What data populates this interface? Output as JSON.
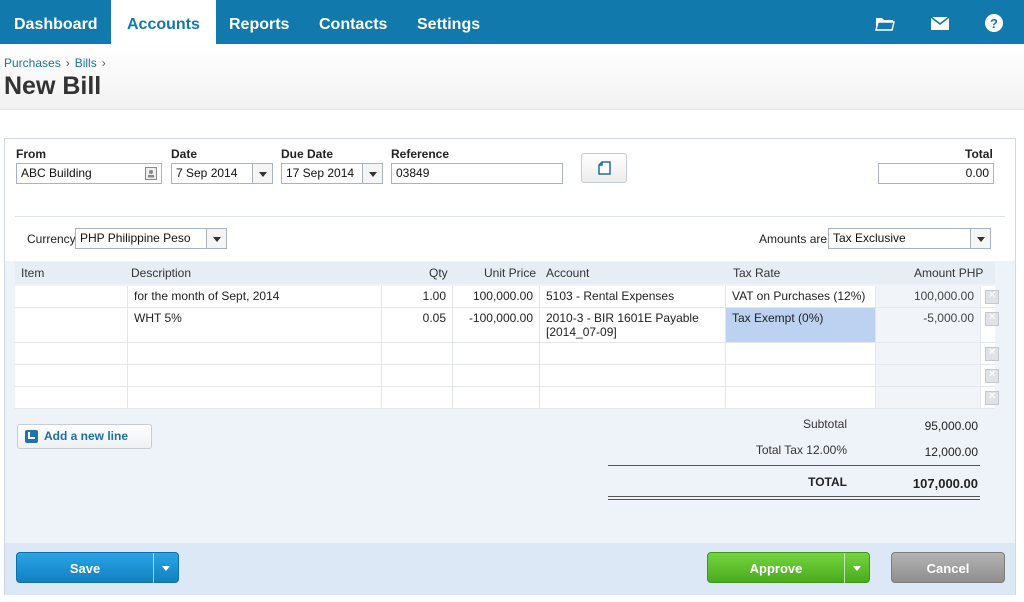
{
  "nav": {
    "tabs": [
      "Dashboard",
      "Accounts",
      "Reports",
      "Contacts",
      "Settings"
    ],
    "active": "Accounts"
  },
  "breadcrumb": {
    "items": [
      "Purchases",
      "Bills"
    ],
    "sep": "›"
  },
  "page_title": "New Bill",
  "form": {
    "from_label": "From",
    "from_value": "ABC Building",
    "date_label": "Date",
    "date_value": "7 Sep 2014",
    "due_label": "Due Date",
    "due_value": "17 Sep 2014",
    "ref_label": "Reference",
    "ref_value": "03849",
    "total_label": "Total",
    "total_value": "0.00",
    "currency_label": "Currency",
    "currency_value": "PHP Philippine Peso",
    "amounts_label": "Amounts are",
    "amounts_value": "Tax Exclusive"
  },
  "table": {
    "headers": {
      "item": "Item",
      "description": "Description",
      "qty": "Qty",
      "unit_price": "Unit Price",
      "account": "Account",
      "tax_rate": "Tax Rate",
      "amount": "Amount PHP"
    },
    "rows": [
      {
        "item": "",
        "description": "for the month of Sept, 2014",
        "qty": "1.00",
        "unit_price": "100,000.00",
        "account": "5103 - Rental Expenses",
        "tax_rate": "VAT on Purchases (12%)",
        "amount": "100,000.00"
      },
      {
        "item": "",
        "description": "WHT 5%",
        "qty": "0.05",
        "unit_price": "-100,000.00",
        "account": "2010-3 - BIR 1601E Payable [2014_07-09]",
        "tax_rate": "Tax Exempt (0%)",
        "amount": "-5,000.00"
      }
    ]
  },
  "add_line_label": "Add a new line",
  "totals": {
    "subtotal_label": "Subtotal",
    "subtotal_value": "95,000.00",
    "tax_label": "Total Tax 12.00%",
    "tax_value": "12,000.00",
    "total_label": "TOTAL",
    "total_value": "107,000.00"
  },
  "buttons": {
    "save": "Save",
    "approve": "Approve",
    "cancel": "Cancel"
  },
  "colors": {
    "nav": "#1279ad",
    "save": "#1b8fd0",
    "approve": "#5cbf2a",
    "cancel": "#9a9a9a"
  },
  "icons": [
    "folder-icon",
    "mail-icon",
    "help-icon",
    "copy-icon",
    "dropdown-arrow-icon",
    "delete-icon",
    "add-line-icon"
  ]
}
